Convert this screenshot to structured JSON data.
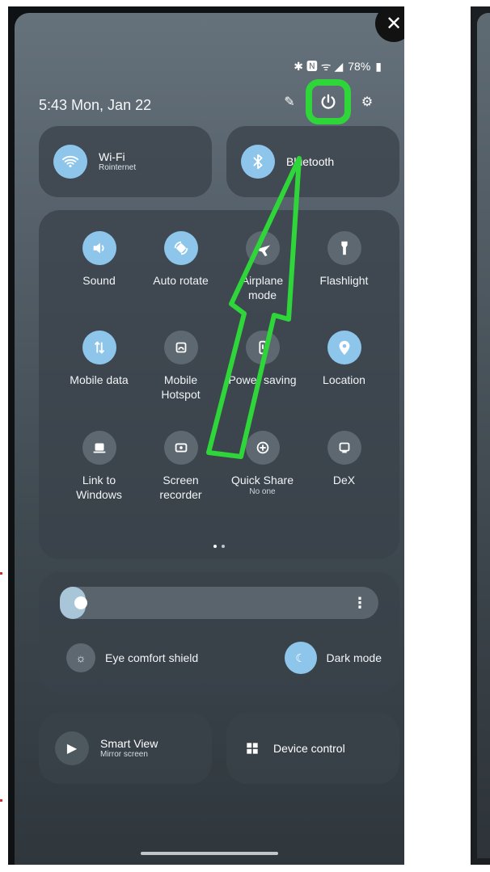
{
  "status_bar": {
    "icons_text": "✱ 🅽 ᯤ ◢",
    "battery": "78%"
  },
  "header": {
    "time_date": "5:43 Mon, Jan 22"
  },
  "quick_toggles": {
    "wifi": {
      "title": "Wi-Fi",
      "subtitle": "Rointernet"
    },
    "bluetooth": {
      "title": "Bluetooth"
    }
  },
  "tiles": [
    {
      "label": "Sound"
    },
    {
      "label": "Auto rotate"
    },
    {
      "label": "Airplane mode"
    },
    {
      "label": "Flashlight"
    },
    {
      "label": "Mobile data"
    },
    {
      "label": "Mobile Hotspot"
    },
    {
      "label": "Power saving"
    },
    {
      "label": "Location"
    },
    {
      "label": "Link to Windows"
    },
    {
      "label": "Screen recorder"
    },
    {
      "label": "Quick Share",
      "sub": "No one"
    },
    {
      "label": "DeX"
    }
  ],
  "brightness": {
    "level": 0.08
  },
  "toggles": {
    "eye_comfort": "Eye comfort shield",
    "dark_mode": "Dark mode"
  },
  "bottom": {
    "smart_view_title": "Smart View",
    "smart_view_sub": "Mirror screen",
    "device_control": "Device control"
  },
  "colors": {
    "highlight": "#2ed63a",
    "accent_blue": "#8ec5ea",
    "panel": "#394249"
  }
}
